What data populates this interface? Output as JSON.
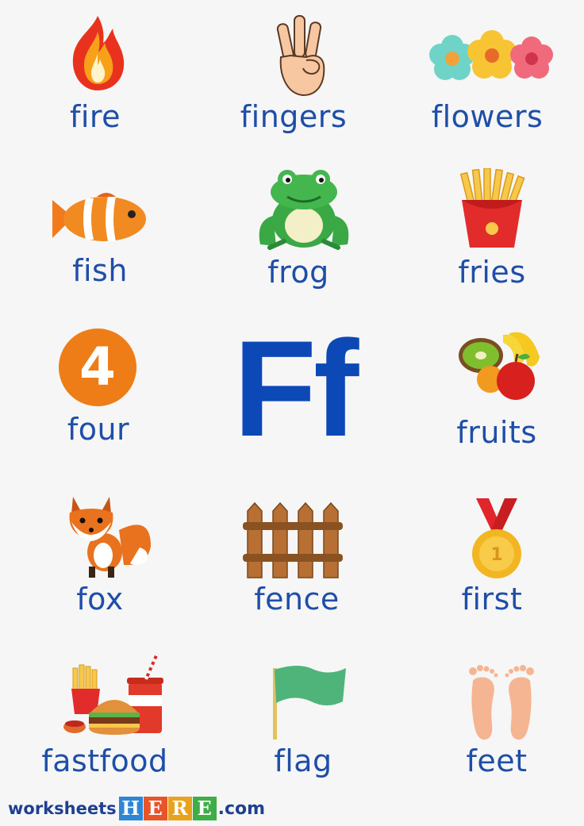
{
  "letter": "Ff",
  "words": {
    "fire": "fire",
    "fingers": "fingers",
    "flowers": "flowers",
    "fish": "fish",
    "frog": "frog",
    "fries": "fries",
    "four": "four",
    "four_numeral": "4",
    "fruits": "fruits",
    "fox": "fox",
    "fence": "fence",
    "first": "first",
    "first_medal_number": "1",
    "fastfood": "fastfood",
    "flag": "flag",
    "feet": "feet"
  },
  "footer": {
    "prefix": "worksheets",
    "brand_letters": [
      "H",
      "E",
      "R",
      "E"
    ],
    "brand_colors": [
      "#2f86d6",
      "#e8552a",
      "#e8a21c",
      "#3fae49"
    ],
    "suffix": ".com"
  },
  "colors": {
    "word_text": "#1f4ea8",
    "big_letter": "#0c49b7",
    "background": "#f6f6f7"
  }
}
